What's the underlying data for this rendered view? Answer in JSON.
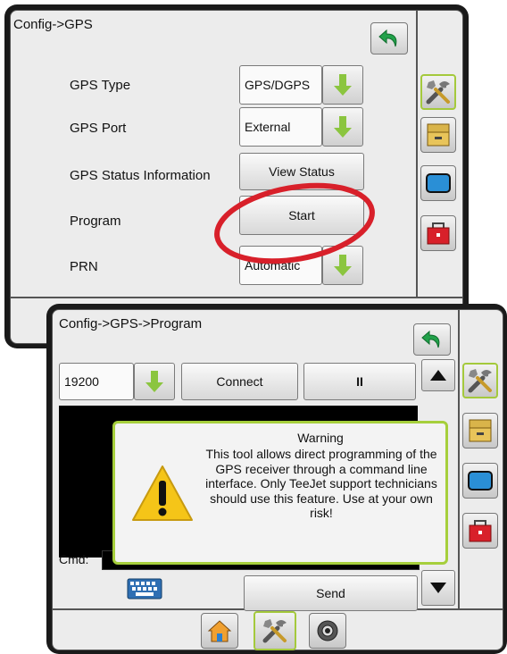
{
  "screen1": {
    "breadcrumb": "Config->GPS",
    "rows": [
      {
        "label": "GPS Type",
        "value": "GPS/DGPS"
      },
      {
        "label": "GPS Port",
        "value": "External"
      },
      {
        "label": "GPS Status Information",
        "button": "View Status"
      },
      {
        "label": "Program",
        "button": "Start"
      },
      {
        "label": "PRN",
        "value": "Automatic"
      }
    ]
  },
  "screen2": {
    "breadcrumb": "Config->GPS->Program",
    "baud_value": "19200",
    "connect_label": "Connect",
    "pause_label": "II",
    "cmd_label": "Cmd:",
    "send_label": "Send"
  },
  "warning": {
    "title": "Warning",
    "message": "This tool allows direct programming of the GPS receiver through a command line interface.  Only TeeJet support technicians should use this feature.  Use at your own risk!"
  },
  "icons": {
    "back": "back-arrow-icon",
    "tools": "tools-icon",
    "filebox": "filebox-icon",
    "screen": "screen-icon",
    "toolbox": "toolbox-icon",
    "home": "home-icon",
    "camera": "camera-icon",
    "keyboard": "keyboard-icon"
  },
  "colors": {
    "frame": "#1a1a1a",
    "accent_green": "#8bc53f",
    "highlight_red": "#d8202a",
    "warning_border": "#a6cf3c"
  }
}
